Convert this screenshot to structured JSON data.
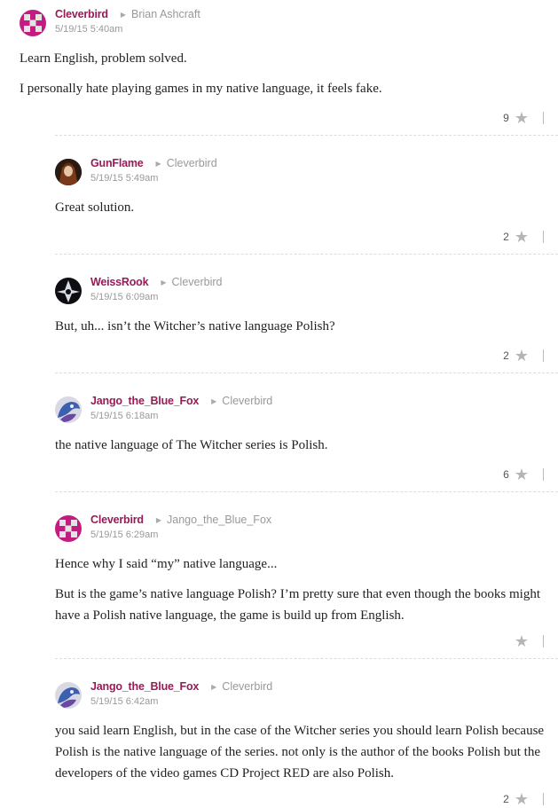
{
  "comments": [
    {
      "author": "Cleverbird",
      "reply_to": "Brian Ashcraft",
      "time": "5/19/15 5:40am",
      "paragraphs": [
        "Learn English, problem solved.",
        "I personally hate playing games in my native language, it feels fake."
      ],
      "stars": "9",
      "avatar": "cleverbird-avatar"
    },
    {
      "author": "GunFlame",
      "reply_to": "Cleverbird",
      "time": "5/19/15 5:49am",
      "paragraphs": [
        "Great solution."
      ],
      "stars": "2",
      "avatar": "gunflame-avatar"
    },
    {
      "author": "WeissRook",
      "reply_to": "Cleverbird",
      "time": "5/19/15 6:09am",
      "paragraphs": [
        "But, uh... isn’t the Witcher’s native language Polish?"
      ],
      "stars": "2",
      "avatar": "weissrook-avatar"
    },
    {
      "author": "Jango_the_Blue_Fox",
      "reply_to": "Cleverbird",
      "time": "5/19/15 6:18am",
      "paragraphs": [
        "the native language of The Witcher series is Polish."
      ],
      "stars": "6",
      "avatar": "jango-avatar"
    },
    {
      "author": "Cleverbird",
      "reply_to": "Jango_the_Blue_Fox",
      "time": "5/19/15 6:29am",
      "paragraphs": [
        "Hence why I said “my” native language...",
        "But is the game’s native language Polish? I’m pretty sure that even though the books might have a Polish native language, the game is build up from English."
      ],
      "stars": "",
      "avatar": "cleverbird-avatar"
    },
    {
      "author": "Jango_the_Blue_Fox",
      "reply_to": "Cleverbird",
      "time": "5/19/15 6:42am",
      "paragraphs": [
        "you said learn English, but in the case of the Witcher series you should learn Polish because Polish is the native language of the series. not only is the author of the books Polish but the developers of the video games CD Project RED are also Polish."
      ],
      "stars": "2",
      "avatar": "jango-avatar"
    }
  ],
  "colors": {
    "author": "#9a1a58",
    "meta": "#999999",
    "text": "#222222",
    "star": "#b5b5b5"
  },
  "icons": {
    "star": "star-icon",
    "reply_arrow": "reply-arrow-icon"
  }
}
